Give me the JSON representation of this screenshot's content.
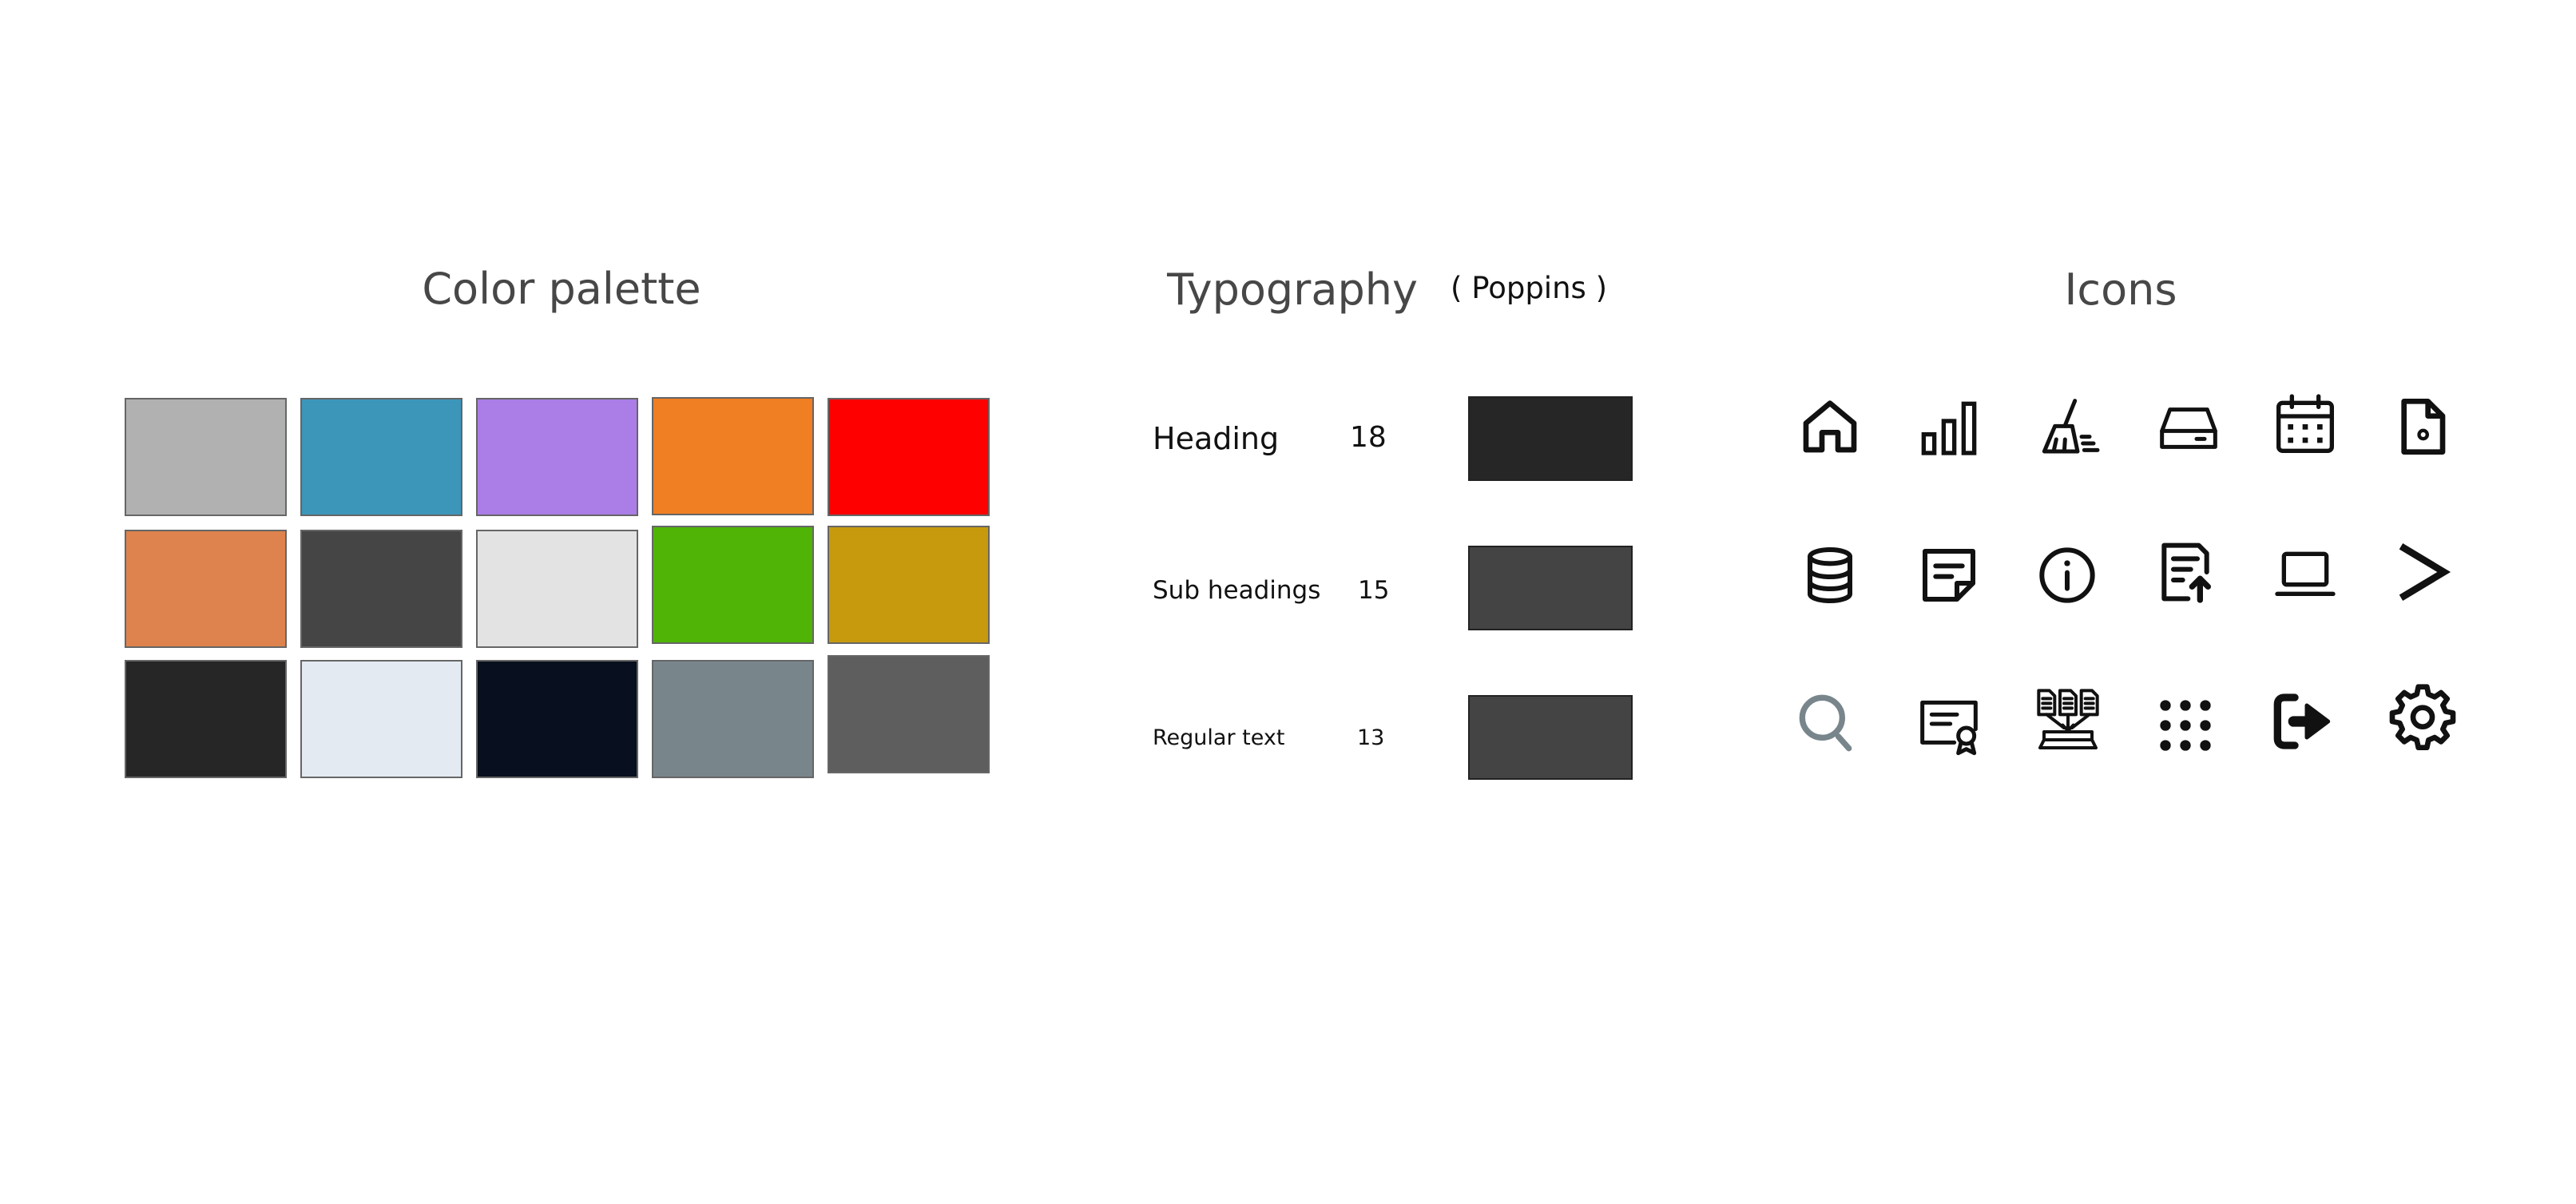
{
  "color_palette": {
    "title": "Color palette",
    "swatches": [
      [
        "#B1B1B1",
        "#3B96BA",
        "#AA7DE7",
        "#EF7F22",
        "#FF0000"
      ],
      [
        "#DE834D",
        "#454545",
        "#E3E3E3",
        "#4FB406",
        "#C79A0E"
      ],
      [
        "#262626",
        "#E4EAF2",
        "#080F1E",
        "#78868C",
        "#5E5E5E"
      ]
    ]
  },
  "typography": {
    "title": "Typography",
    "font_note": "( Poppins )",
    "rows": [
      {
        "label": "Heading",
        "size": "18",
        "sample_color": "#262626"
      },
      {
        "label": "Sub headings",
        "size": "15",
        "sample_color": "#444444"
      },
      {
        "label": "Regular text",
        "size": "13",
        "sample_color": "#444444"
      }
    ]
  },
  "icons": {
    "title": "Icons",
    "grid": [
      [
        "home-icon",
        "bar-chart-icon",
        "broom-icon",
        "hard-drive-icon",
        "calendar-icon",
        "file-settings-icon"
      ],
      [
        "database-icon",
        "sticky-note-icon",
        "info-icon",
        "file-upload-icon",
        "laptop-icon",
        "chevron-right-icon"
      ],
      [
        "search-icon",
        "certificate-icon",
        "file-merge-icon",
        "apps-grid-icon",
        "logout-icon",
        "gear-icon"
      ]
    ],
    "search_icon_color": "#78868C"
  }
}
